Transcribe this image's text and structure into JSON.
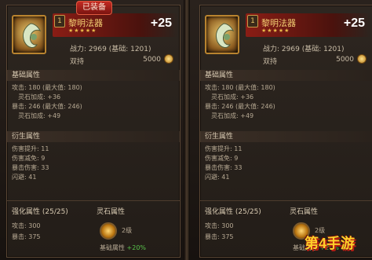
{
  "left": {
    "badge": "已装备",
    "slot": "1",
    "name": "黎明法器",
    "stars": "★★★★★",
    "enhance": "+25",
    "power": "战力: 2969",
    "base": "(基础: 1201)",
    "dual": "双持",
    "gold": "5000",
    "basic_title": "基础属性",
    "basic": [
      "攻击: 180 (最大值: 180)",
      "灵石加成: +36",
      "暴击: 246 (最大值: 246)",
      "灵石加成: +49"
    ],
    "derived_title": "衍生属性",
    "derived": [
      "伤害提升: 11",
      "伤害减免: 9",
      "暴击伤害: 33",
      "闪避: 41"
    ],
    "enh_title": "强化属性 (25/25)",
    "enh": [
      "攻击: 300",
      "暴击: 375"
    ],
    "stone_title": "灵石属性",
    "stone_level": "2级",
    "stone_bonus_label": "基础属性",
    "stone_bonus": "+20%"
  },
  "right": {
    "slot": "1",
    "name": "黎明法器",
    "stars": "★★★★★",
    "enhance": "+25",
    "power": "战力: 2969",
    "base": "(基础: 1201)",
    "dual": "双持",
    "gold": "5000",
    "basic_title": "基础属性",
    "basic": [
      "攻击: 180 (最大值: 180)",
      "灵石加成: +36",
      "暴击: 246 (最大值: 246)",
      "灵石加成: +49"
    ],
    "derived_title": "衍生属性",
    "derived": [
      "伤害提升: 11",
      "伤害减免: 9",
      "暴击伤害: 33",
      "闪避: 41"
    ],
    "enh_title": "强化属性 (25/25)",
    "enh": [
      "攻击: 300",
      "暴击: 375"
    ],
    "stone_title": "灵石属性",
    "stone_level": "2级",
    "stone_bonus_label": "基础属性",
    "stone_bonus": "+20%"
  },
  "watermark": "第4手游"
}
